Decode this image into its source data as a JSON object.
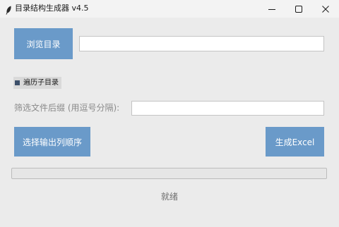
{
  "window": {
    "title": "目录结构生成器 v4.5",
    "icon": "feather-icon",
    "controls": [
      "minimize-icon",
      "maximize-icon",
      "close-icon"
    ]
  },
  "main": {
    "browse_button": "浏览目录",
    "directory_value": "",
    "subdir_checkbox": {
      "label": "遍历子目录",
      "checked": true
    },
    "suffix_label": "筛选文件后缀 (用逗号分隔):",
    "suffix_value": "",
    "order_button": "选择输出列顺序",
    "excel_button": "生成Excel",
    "progress": 0,
    "status": "就绪"
  },
  "colors": {
    "accent": "#6a9ac9",
    "background": "#ebebeb",
    "titlebar": "#f3f3f3"
  }
}
